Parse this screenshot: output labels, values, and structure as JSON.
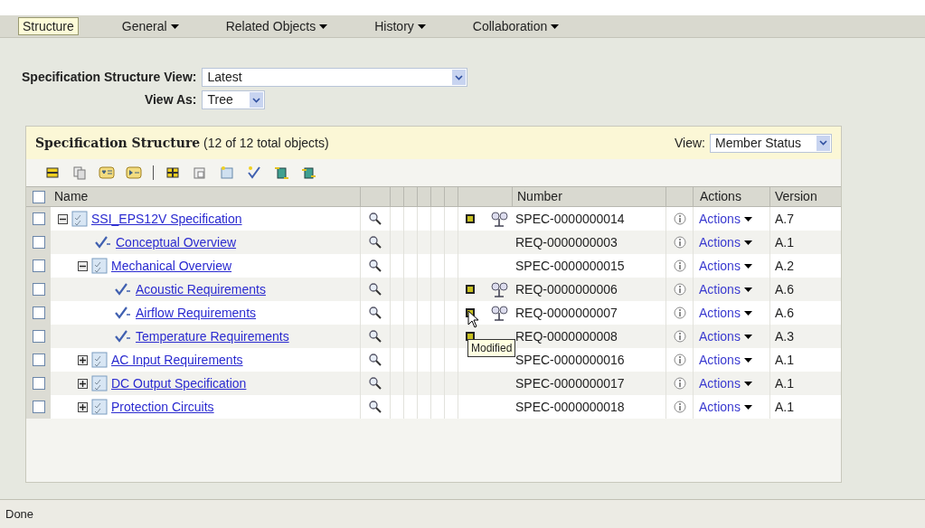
{
  "menu": [
    {
      "label": "Structure",
      "selected": true,
      "dropdown": false
    },
    {
      "label": "General",
      "selected": false,
      "dropdown": true
    },
    {
      "label": "Related Objects",
      "selected": false,
      "dropdown": true
    },
    {
      "label": "History",
      "selected": false,
      "dropdown": true
    },
    {
      "label": "Collaboration",
      "selected": false,
      "dropdown": true
    }
  ],
  "form": {
    "view_label": "Specification Structure View:",
    "view_value": "Latest",
    "view_as_label": "View As:",
    "view_as_value": "Tree"
  },
  "panel": {
    "title": "Specification Structure",
    "count": "(12 of 12 total objects)",
    "view_label": "View:",
    "view_value": "Member Status",
    "all_checked": false,
    "columns": [
      "Name",
      "Number",
      "Actions",
      "Version"
    ],
    "rows": [
      {
        "kind": "spec",
        "name": "SSI_EPS12V Specification",
        "number": "SPEC-0000000014",
        "action": "Actions",
        "version": "A.7",
        "checked": false,
        "expanded": true,
        "modified": true,
        "where_used": true,
        "children": [
          {
            "kind": "req",
            "name": "Conceptual Overview",
            "number": "REQ-0000000003",
            "action": "Actions",
            "version": "A.1",
            "checked": false,
            "modified": false,
            "where_used": false
          },
          {
            "kind": "spec",
            "name": "Mechanical Overview",
            "number": "SPEC-0000000015",
            "action": "Actions",
            "version": "A.2",
            "checked": false,
            "expanded": true,
            "modified": false,
            "where_used": false,
            "children": [
              {
                "kind": "req",
                "name": "Acoustic Requirements",
                "number": "REQ-0000000006",
                "action": "Actions",
                "version": "A.6",
                "checked": false,
                "modified": true,
                "where_used": true
              },
              {
                "kind": "req",
                "name": "Airflow Requirements",
                "number": "REQ-0000000007",
                "action": "Actions",
                "version": "A.6",
                "checked": false,
                "modified": true,
                "where_used": true
              },
              {
                "kind": "req",
                "name": "Temperature Requirements",
                "number": "REQ-0000000008",
                "action": "Actions",
                "version": "A.3",
                "checked": false,
                "modified": true,
                "where_used": false,
                "tooltip": "Modified"
              }
            ]
          },
          {
            "kind": "spec",
            "name": "AC Input Requirements",
            "number": "SPEC-0000000016",
            "action": "Actions",
            "version": "A.1",
            "checked": false,
            "expanded": false,
            "modified": false,
            "where_used": false
          },
          {
            "kind": "spec",
            "name": "DC Output Specification",
            "number": "SPEC-0000000017",
            "action": "Actions",
            "version": "A.1",
            "checked": false,
            "expanded": false,
            "modified": false,
            "where_used": false
          },
          {
            "kind": "spec",
            "name": "Protection Circuits",
            "number": "SPEC-0000000018",
            "action": "Actions",
            "version": "A.1",
            "checked": false,
            "expanded": false,
            "modified": false,
            "where_used": false
          }
        ]
      }
    ]
  },
  "status_bar": "Done"
}
